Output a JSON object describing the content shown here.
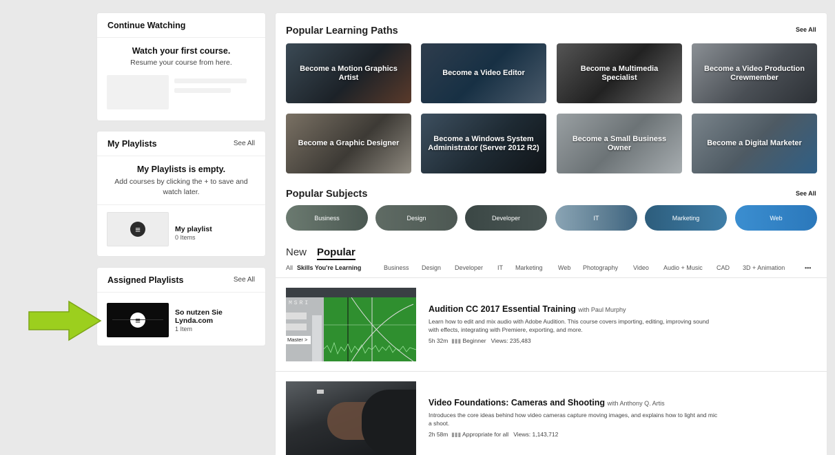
{
  "continue_watching": {
    "title": "Continue Watching",
    "heading": "Watch your first course.",
    "subtext": "Resume your course from here."
  },
  "my_playlists": {
    "title": "My Playlists",
    "see_all": "See All",
    "empty_heading": "My Playlists is empty.",
    "empty_sub": "Add courses by clicking the + to save and watch later.",
    "playlist": {
      "name": "My playlist",
      "count": "0 Items"
    }
  },
  "assigned_playlists": {
    "title": "Assigned Playlists",
    "see_all": "See All",
    "playlist": {
      "name": "So nutzen Sie Lynda.com",
      "count": "1 Item"
    }
  },
  "learning_paths": {
    "title": "Popular Learning Paths",
    "see_all": "See All",
    "items": [
      "Become a Motion Graphics Artist",
      "Become a Video Editor",
      "Become a Multimedia Specialist",
      "Become a Video Production Crewmember",
      "Become a Graphic Designer",
      "Become a Windows System Administrator (Server 2012 R2)",
      "Become a Small Business Owner",
      "Become a Digital Marketer"
    ]
  },
  "subjects": {
    "title": "Popular Subjects",
    "see_all": "See All",
    "items": [
      "Business",
      "Design",
      "Developer",
      "IT",
      "Marketing",
      "Web"
    ]
  },
  "tabs": {
    "new": "New",
    "popular": "Popular"
  },
  "filters": [
    "All",
    "Skills You're Learning",
    "Business",
    "Design",
    "Developer",
    "IT",
    "Marketing",
    "Web",
    "Photography",
    "Video",
    "Audio + Music",
    "CAD",
    "3D + Animation",
    "•••"
  ],
  "courses": [
    {
      "title": "Audition CC 2017 Essential Training",
      "author": "with Paul Murphy",
      "description": "Learn how to edit and mix audio with Adobe Audition. This course covers importing, editing, improving sound with effects, integrating with Premiere, exporting, and more.",
      "duration": "5h 32m",
      "level": "Beginner",
      "views": "Views: 235,483",
      "thumb_label": "Master >"
    },
    {
      "title": "Video Foundations: Cameras and Shooting",
      "author": "with Anthony Q. Artis",
      "description": "Introduces the core ideas behind how video cameras capture moving images, and explains how to light and mic a shoot.",
      "duration": "2h 58m",
      "level": "Appropriate for all",
      "views": "Views: 1,143,712"
    }
  ],
  "colors": {
    "arrow": "#9ccf1e",
    "subjects": [
      "#5d6a62",
      "#57635e",
      "#3e4a47",
      "#6f8ea0",
      "#3a6e8e",
      "#3d86c6"
    ]
  }
}
